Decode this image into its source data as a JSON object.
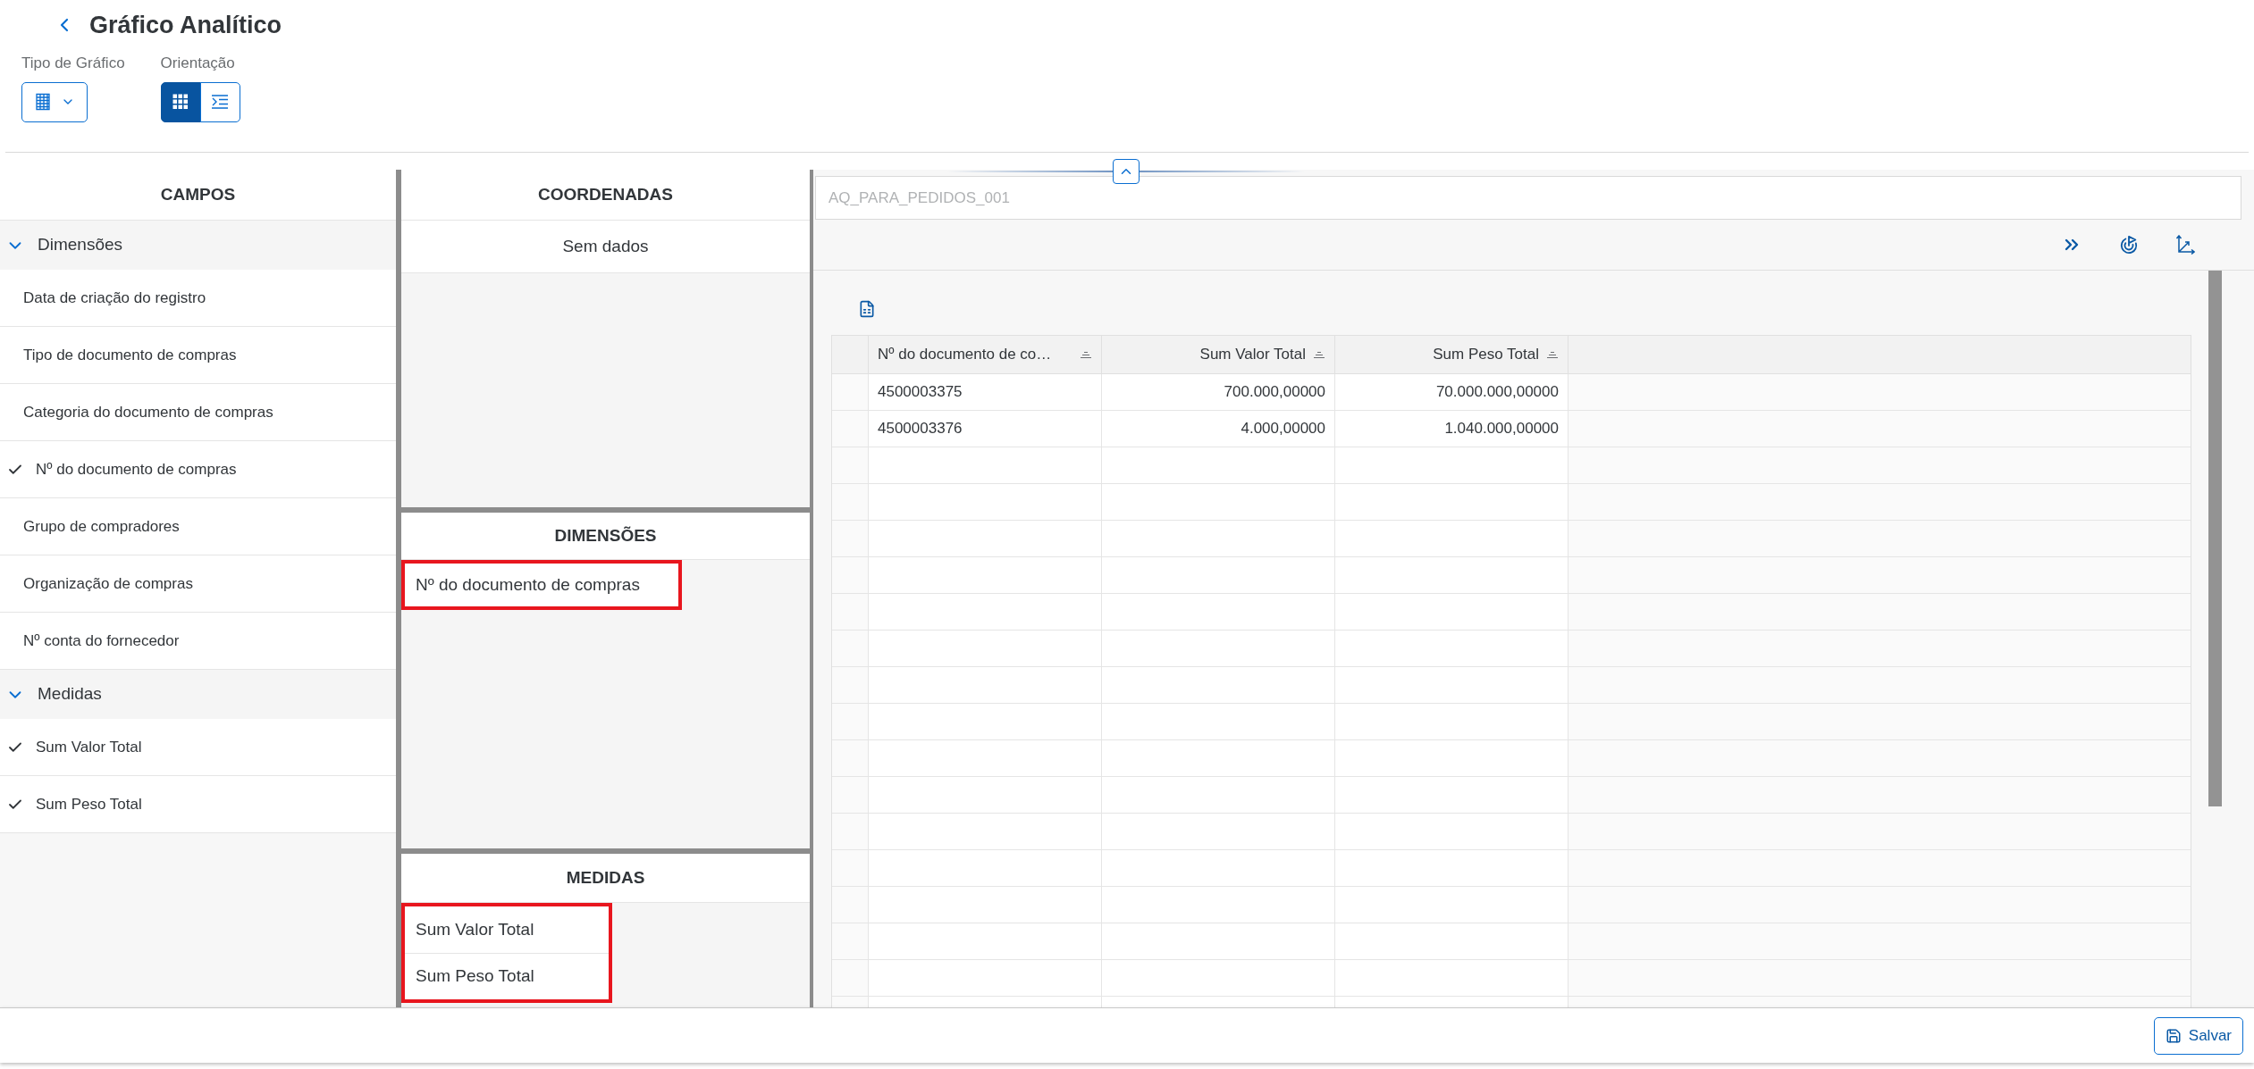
{
  "page": {
    "title": "Gráfico Analítico"
  },
  "chart_type": {
    "label": "Tipo de Gráfico"
  },
  "orientation": {
    "label": "Orientação",
    "options": [
      {
        "kind": "grid",
        "selected": true
      },
      {
        "kind": "indent",
        "selected": false
      }
    ]
  },
  "fields_panel": {
    "title": "CAMPOS",
    "groups": [
      {
        "label": "Dimensões",
        "expanded": true,
        "items": [
          {
            "label": "Data de criação do registro",
            "checked": false
          },
          {
            "label": "Tipo de documento de compras",
            "checked": false
          },
          {
            "label": "Categoria do documento de compras",
            "checked": false
          },
          {
            "label": "Nº do documento de compras",
            "checked": true
          },
          {
            "label": "Grupo de compradores",
            "checked": false
          },
          {
            "label": "Organização de compras",
            "checked": false
          },
          {
            "label": "Nº conta do fornecedor",
            "checked": false
          }
        ]
      },
      {
        "label": "Medidas",
        "expanded": true,
        "items": [
          {
            "label": "Sum Valor Total",
            "checked": true
          },
          {
            "label": "Sum Peso Total",
            "checked": true
          }
        ]
      }
    ]
  },
  "coordinates": {
    "title": "COORDENADAS",
    "empty_text": "Sem dados"
  },
  "dimensions": {
    "title": "DIMENSÕES",
    "highlighted": true,
    "items": [
      "Nº do documento de compras"
    ]
  },
  "measures": {
    "title": "MEDIDAS",
    "highlighted": true,
    "items": [
      "Sum Valor Total",
      "Sum Peso Total"
    ]
  },
  "query": {
    "value": "AQ_PARA_PEDIDOS_001"
  },
  "table": {
    "columns": [
      {
        "label": "Nº do documento de co…"
      },
      {
        "label": "Sum Valor Total"
      },
      {
        "label": "Sum Peso Total"
      }
    ],
    "rows": [
      [
        "4500003375",
        "700.000,00000",
        "70.000.000,00000"
      ],
      [
        "4500003376",
        "4.000,00000",
        "1.040.000,00000"
      ]
    ]
  },
  "footer": {
    "save_label": "Salvar"
  }
}
